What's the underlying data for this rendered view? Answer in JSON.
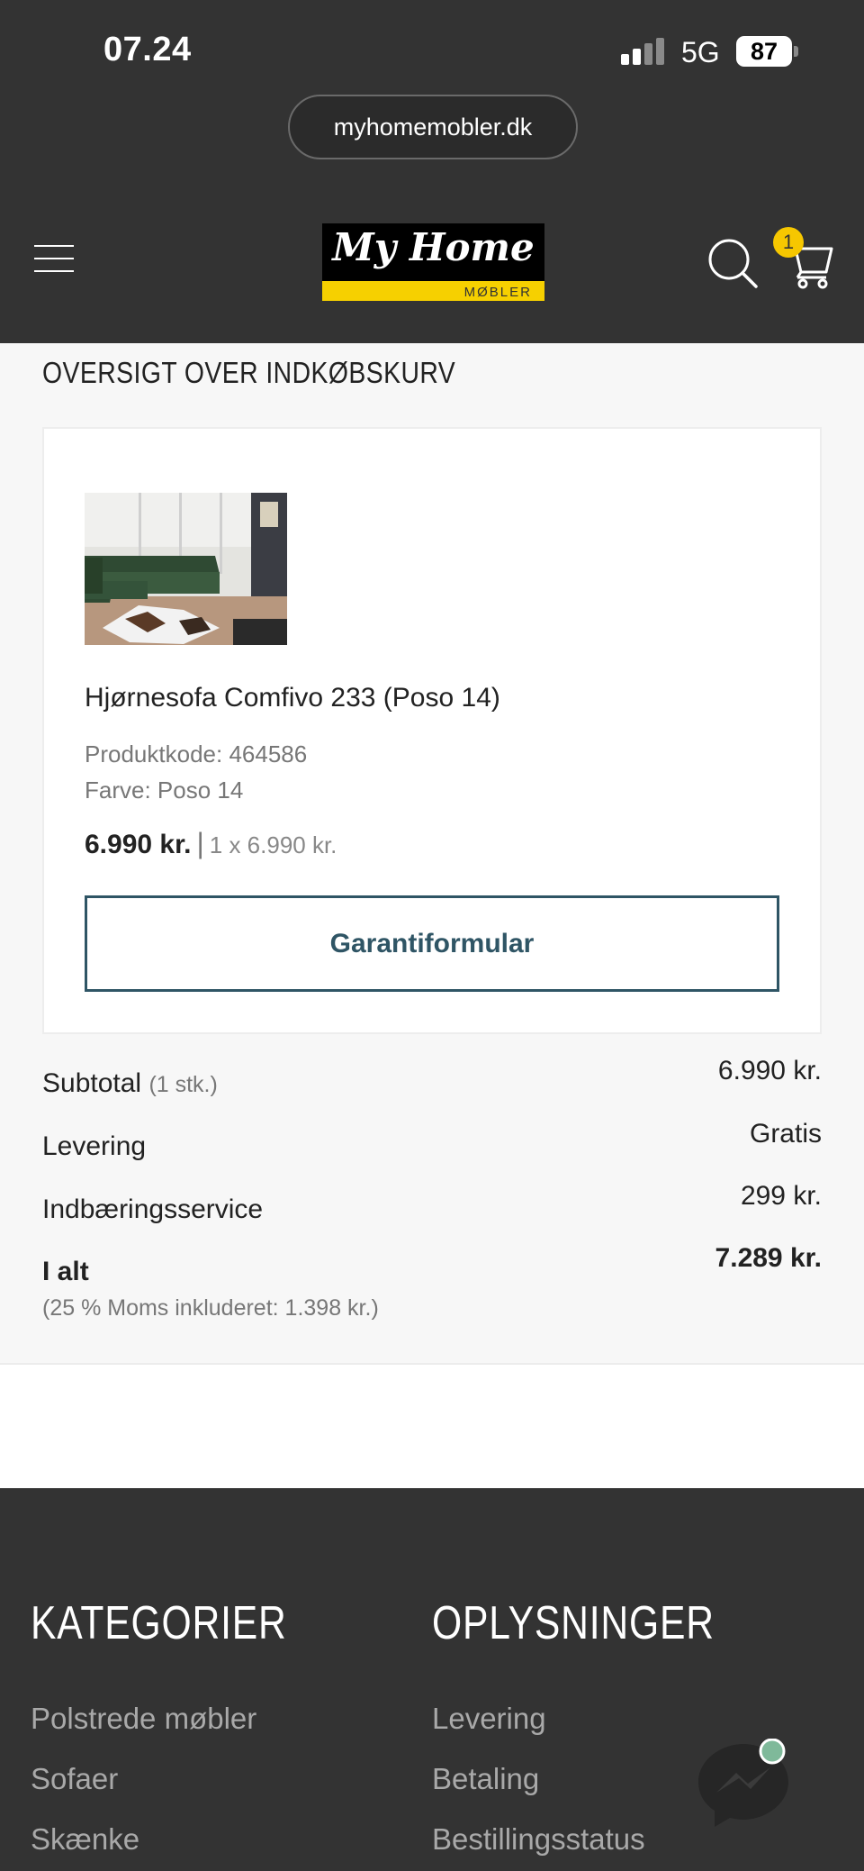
{
  "status_bar": {
    "time": "07.24",
    "network": "5G",
    "battery": "87"
  },
  "browser": {
    "url": "myhomemobler.dk"
  },
  "header": {
    "logo_text": "My Home",
    "logo_subtext": "MØBLER",
    "cart_count": "1"
  },
  "cart": {
    "title": "OVERSIGT OVER INDKØBSKURV",
    "item": {
      "name": "Hjørnesofa Comfivo 233 (Poso 14)",
      "code_label": "Produktkode:",
      "code_value": "464586",
      "color_label": "Farve:",
      "color_value": "Poso 14",
      "price": "6.990 kr.",
      "separator": "|",
      "unit_price": "1 x 6.990 kr.",
      "warranty_button": "Garantiformular"
    },
    "summary": {
      "subtotal_label": "Subtotal",
      "subtotal_count": "(1 stk.)",
      "subtotal_value": "6.990 kr.",
      "delivery_label": "Levering",
      "delivery_value": "Gratis",
      "carry_in_label": "Indbæringsservice",
      "carry_in_value": "299 kr.",
      "total_label": "I alt",
      "total_value": "7.289 kr.",
      "vat_note": "(25 % Moms inkluderet: 1.398 kr.)"
    }
  },
  "footer": {
    "categories_heading": "KATEGORIER",
    "categories": [
      "Polstrede møbler",
      "Sofaer",
      "Skænke"
    ],
    "info_heading": "OPLYSNINGER",
    "info_links": [
      "Levering",
      "Betaling",
      "Bestillingsstatus"
    ]
  },
  "colors": {
    "dark_bg": "#333333",
    "accent_yellow": "#f6c700",
    "button_teal": "#2f5565",
    "online_dot": "#7fb99a"
  }
}
